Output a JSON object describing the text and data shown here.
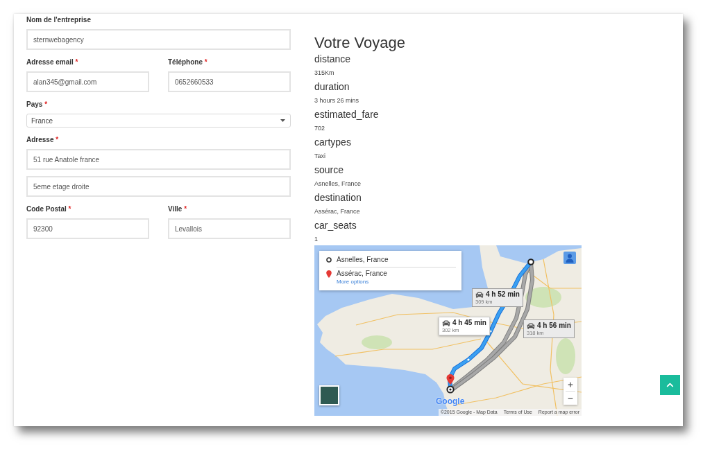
{
  "form": {
    "rows": [
      {
        "fields": [
          {
            "label": "Nom de l'entreprise",
            "kind": "text",
            "value": "sternwebagency"
          }
        ]
      },
      {
        "fields": [
          {
            "label": "Adresse email",
            "required_mark": "*",
            "kind": "text",
            "value": "alan345@gmail.com"
          },
          {
            "label": "Téléphone",
            "required_mark": "*",
            "kind": "text",
            "value": "0652660533"
          }
        ]
      },
      {
        "fields": [
          {
            "label": "Pays",
            "required_mark": "*",
            "kind": "select",
            "value": "France"
          }
        ]
      },
      {
        "fields": [
          {
            "label": "Adresse",
            "required_mark": "*",
            "kind": "text",
            "value": "51 rue Anatole france"
          }
        ]
      },
      {
        "fields": [
          {
            "kind": "text",
            "value": "5eme etage droite"
          }
        ]
      },
      {
        "fields": [
          {
            "label": "Code Postal",
            "required_mark": "*",
            "kind": "text",
            "value": "92300"
          },
          {
            "label": "Ville",
            "required_mark": "*",
            "kind": "text",
            "value": "Levallois"
          }
        ]
      }
    ]
  },
  "trip": {
    "title": "Votre Voyage",
    "details": [
      {
        "label": "distance",
        "value": "315Km"
      },
      {
        "label": "duration",
        "value": "3 hours 26 mins"
      },
      {
        "label": "estimated_fare",
        "value": "702"
      },
      {
        "label": "cartypes",
        "value": "Taxi"
      },
      {
        "label": "source",
        "value": "Asnelles, France"
      },
      {
        "label": "destination",
        "value": "Assérac, France"
      },
      {
        "label": "car_seats",
        "value": "1"
      }
    ]
  },
  "map": {
    "directions": {
      "origin": "Asnelles, France",
      "destination": "Assérac, France",
      "more_options": "More options"
    },
    "routes": [
      {
        "duration": "4 h 52 min",
        "distance": "309 km",
        "selected": false
      },
      {
        "duration": "4 h 45 min",
        "distance": "302 km",
        "selected": true
      },
      {
        "duration": "4 h 56 min",
        "distance": "318 km",
        "selected": false
      }
    ],
    "logo": "Google",
    "attribution": "©2015 Google - Map Data",
    "links": [
      "Terms of Use",
      "Report a map error"
    ]
  }
}
